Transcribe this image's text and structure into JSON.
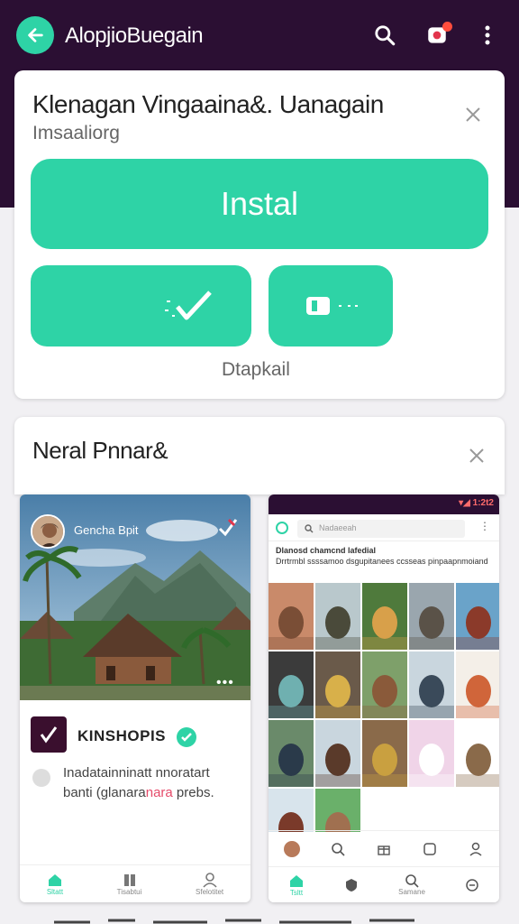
{
  "appbar": {
    "title": "AlopjioBuegain",
    "accent": "#2ed3a6",
    "background": "#2b0f33",
    "icons": [
      "back-arrow-icon",
      "search-icon",
      "notification-icon",
      "more-vertical-icon"
    ]
  },
  "install_card": {
    "title": "Klenagan Vingaaina&. Uanagain",
    "subtitle": "Imsaaliorg",
    "install_label": "Instal",
    "secondary_label": "Dtapkail",
    "icons": [
      "close-icon",
      "check-icon",
      "toggle-icon"
    ]
  },
  "screens_card": {
    "title": "Neral Pnnar&"
  },
  "preview_left": {
    "hero_label": "Gencha Bpit",
    "brand_name": "KINSHOPIS",
    "description": "Inadatainninatt nnoratart",
    "description2_pre": "banti (glanara",
    "description2_highlight": "nara",
    "description2_post": " prebs.",
    "nav": [
      "Sltatt",
      "Tisabtui",
      "Sfelotitet"
    ]
  },
  "preview_right": {
    "status": "▾◢ 1:2t2",
    "search_placeholder": "Nadaeeah",
    "headline_bold": "Dlanosd chamcnd lafedial",
    "headline_rest": "Drrtrmbl ssssamoo dsgupitanees ccsseas pinpaapnmoiand",
    "nav": [
      "Tsltt",
      "",
      "",
      "Samane",
      ""
    ]
  }
}
